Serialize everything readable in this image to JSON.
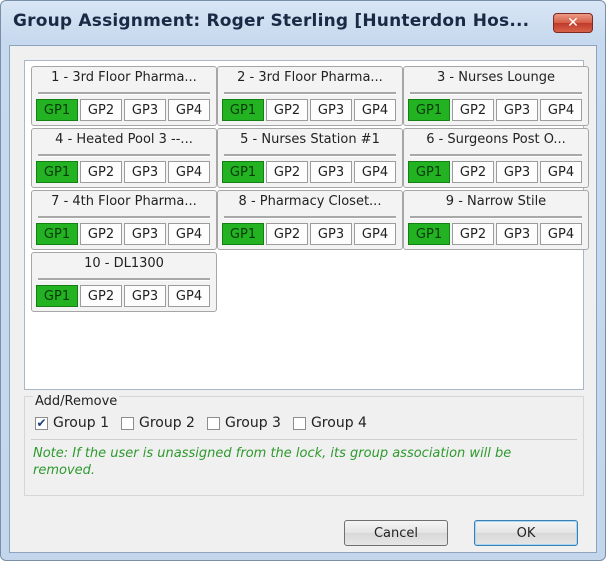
{
  "window": {
    "title": "Group Assignment: Roger Sterling [Hunterdon Hos...",
    "close_label": "✕"
  },
  "locks": [
    {
      "name": "1 - 3rd Floor Pharma...",
      "groups": [
        "GP1",
        "GP2",
        "GP3",
        "GP4"
      ],
      "active": [
        true,
        false,
        false,
        false
      ]
    },
    {
      "name": "2 - 3rd Floor Pharma...",
      "groups": [
        "GP1",
        "GP2",
        "GP3",
        "GP4"
      ],
      "active": [
        true,
        false,
        false,
        false
      ]
    },
    {
      "name": "3 - Nurses Lounge",
      "groups": [
        "GP1",
        "GP2",
        "GP3",
        "GP4"
      ],
      "active": [
        true,
        false,
        false,
        false
      ]
    },
    {
      "name": "4 - Heated Pool 3 --...",
      "groups": [
        "GP1",
        "GP2",
        "GP3",
        "GP4"
      ],
      "active": [
        true,
        false,
        false,
        false
      ]
    },
    {
      "name": "5 - Nurses Station #1",
      "groups": [
        "GP1",
        "GP2",
        "GP3",
        "GP4"
      ],
      "active": [
        true,
        false,
        false,
        false
      ]
    },
    {
      "name": "6 - Surgeons Post O...",
      "groups": [
        "GP1",
        "GP2",
        "GP3",
        "GP4"
      ],
      "active": [
        true,
        false,
        false,
        false
      ]
    },
    {
      "name": "7 - 4th Floor Pharma...",
      "groups": [
        "GP1",
        "GP2",
        "GP3",
        "GP4"
      ],
      "active": [
        true,
        false,
        false,
        false
      ]
    },
    {
      "name": "8 - Pharmacy Closet...",
      "groups": [
        "GP1",
        "GP2",
        "GP3",
        "GP4"
      ],
      "active": [
        true,
        false,
        false,
        false
      ]
    },
    {
      "name": "9 - Narrow Stile",
      "groups": [
        "GP1",
        "GP2",
        "GP3",
        "GP4"
      ],
      "active": [
        true,
        false,
        false,
        false
      ]
    },
    {
      "name": "10 - DL1300",
      "groups": [
        "GP1",
        "GP2",
        "GP3",
        "GP4"
      ],
      "active": [
        true,
        false,
        false,
        false
      ]
    }
  ],
  "add_remove": {
    "legend": "Add/Remove",
    "checkboxes": [
      {
        "label": "Group 1",
        "checked": true
      },
      {
        "label": "Group 2",
        "checked": false
      },
      {
        "label": "Group 3",
        "checked": false
      },
      {
        "label": "Group 4",
        "checked": false
      }
    ],
    "note": "Note: If the user is unassigned from the lock, its group association will be removed."
  },
  "buttons": {
    "cancel": "Cancel",
    "ok": "OK"
  },
  "colors": {
    "active_group": "#22b222",
    "note_text": "#2e9a2e"
  }
}
